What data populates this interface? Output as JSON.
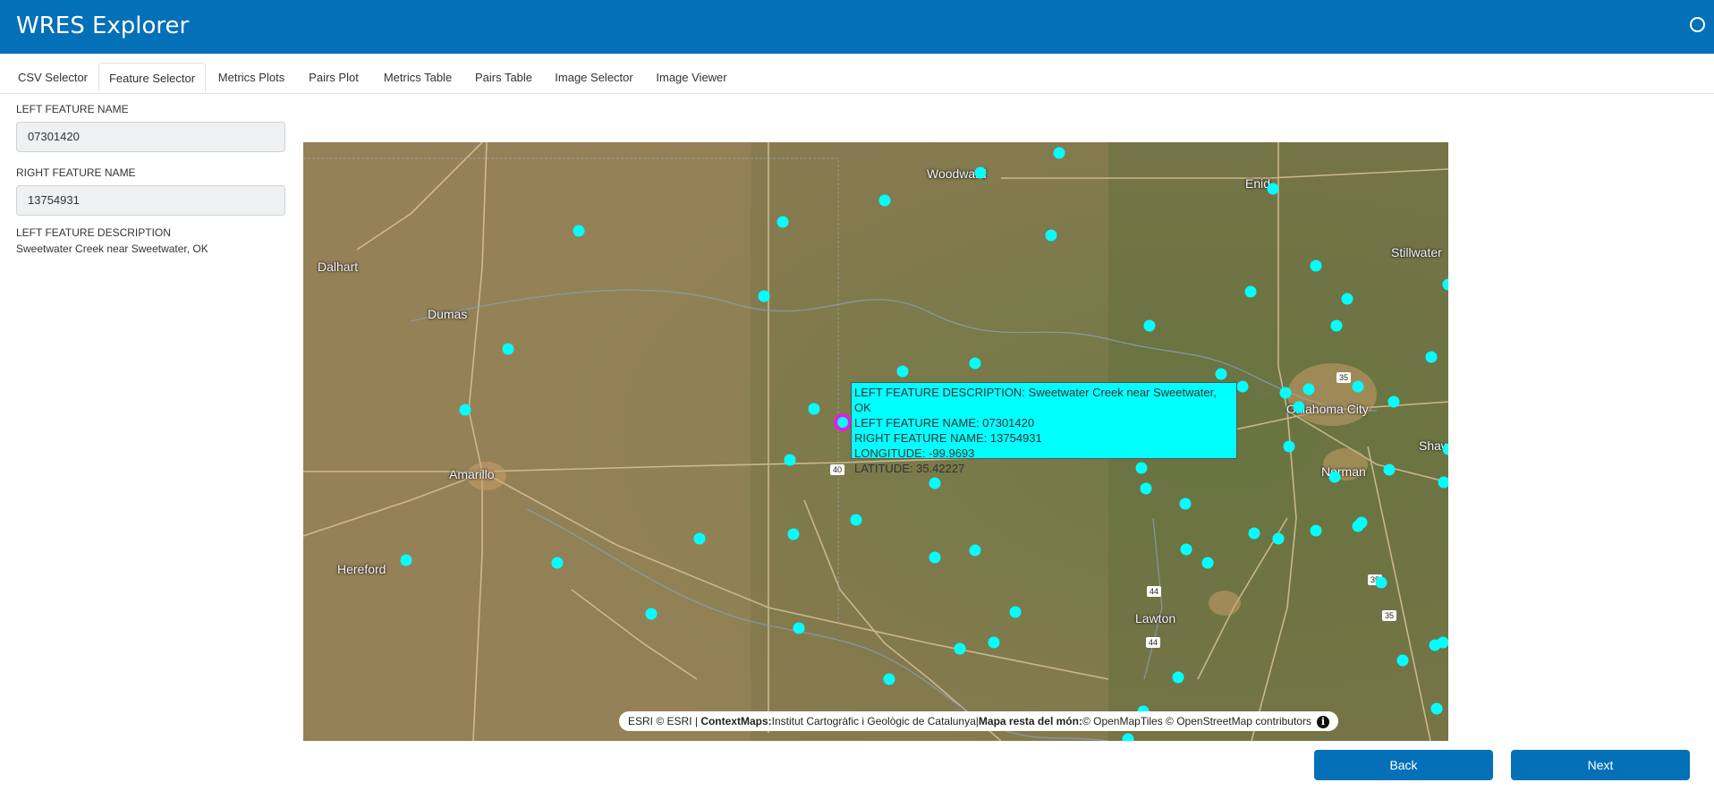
{
  "app": {
    "title": "WRES Explorer"
  },
  "tabs": [
    {
      "label": "CSV Selector"
    },
    {
      "label": "Feature Selector"
    },
    {
      "label": "Metrics Plots"
    },
    {
      "label": "Pairs Plot"
    },
    {
      "label": "Metrics Table"
    },
    {
      "label": "Pairs Table"
    },
    {
      "label": "Image Selector"
    },
    {
      "label": "Image Viewer"
    }
  ],
  "active_tab": "Feature Selector",
  "sidebar": {
    "left_name_label": "LEFT FEATURE NAME",
    "left_name_value": "07301420",
    "right_name_label": "RIGHT FEATURE NAME",
    "right_name_value": "13754931",
    "left_desc_label": "LEFT FEATURE DESCRIPTION",
    "left_desc_value": "Sweetwater Creek near Sweetwater, OK"
  },
  "map": {
    "cities": [
      "Woodward",
      "Enid",
      "Stillwater",
      "Dalhart",
      "Dumas",
      "Amarillo",
      "Oklahoma City",
      "Norman",
      "Shaw",
      "Hereford",
      "Lawton"
    ],
    "route_shields": [
      "35",
      "40",
      "44",
      "44",
      "35",
      "35"
    ],
    "marker_color": "#00ffff",
    "selected_marker_color": "#e020e0",
    "tooltip": {
      "line1": "LEFT FEATURE DESCRIPTION: Sweetwater Creek near Sweetwater, OK",
      "line2": "LEFT FEATURE NAME: 07301420",
      "line3": "RIGHT FEATURE NAME: 13754931",
      "line4": "LONGITUDE: -99.9693",
      "line5": "LATITUDE: 35.42227"
    },
    "attribution": {
      "esri": "ESRI © ESRI | ",
      "cm_label": "ContextMaps:",
      "cm_text": "Institut Cartogràfic i Geològic de Catalunya",
      "sep": "|",
      "mrm_label": "Mapa resta del món:",
      "mrm_text": "© OpenMapTiles © OpenStreetMap contributors",
      "info_icon": "i"
    }
  },
  "buttons": {
    "back": "Back",
    "next": "Next"
  }
}
